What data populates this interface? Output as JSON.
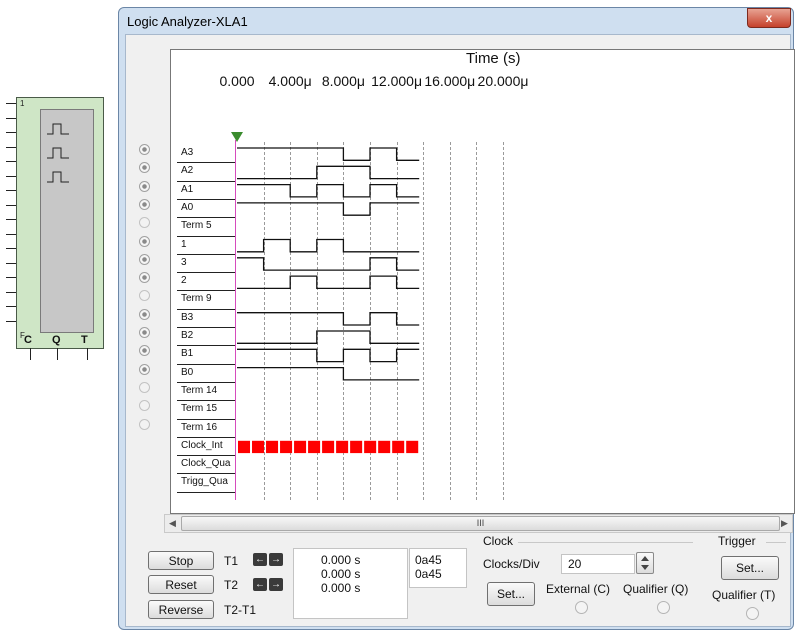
{
  "symbol": {
    "top_pin_label": "1",
    "bottom_pin_label": "F",
    "terminals": [
      "C",
      "Q",
      "T"
    ]
  },
  "window": {
    "title": "Logic Analyzer-XLA1",
    "close_glyph": "x"
  },
  "display": {
    "axis_title": "Time (s)",
    "tick_labels": [
      "0.000",
      "4.000μ",
      "8.000μ",
      "12.000μ",
      "16.000μ",
      "20.000μ"
    ],
    "rows": [
      {
        "label": "A3",
        "active": true,
        "level0": 1,
        "edges": [
          8,
          10,
          12
        ]
      },
      {
        "label": "A2",
        "active": true,
        "level0": 0,
        "edges": [
          6,
          10
        ]
      },
      {
        "label": "A1",
        "active": true,
        "level0": 1,
        "edges": [
          4,
          6,
          8,
          10,
          12
        ]
      },
      {
        "label": "A0",
        "active": true,
        "level0": 1,
        "edges": [
          8,
          10
        ]
      },
      {
        "label": "Term 5",
        "active": false
      },
      {
        "label": "1",
        "active": true,
        "level0": 0,
        "edges": [
          2,
          4,
          6,
          8
        ]
      },
      {
        "label": "3",
        "active": true,
        "level0": 1,
        "edges": [
          2,
          10,
          12
        ]
      },
      {
        "label": "2",
        "active": true,
        "level0": 0,
        "edges": [
          4,
          6,
          10,
          12
        ]
      },
      {
        "label": "Term 9",
        "active": false
      },
      {
        "label": "B3",
        "active": true,
        "level0": 1,
        "edges": [
          8,
          10,
          12
        ]
      },
      {
        "label": "B2",
        "active": true,
        "level0": 0,
        "edges": [
          6,
          10
        ]
      },
      {
        "label": "B1",
        "active": true,
        "level0": 1,
        "edges": [
          6,
          8,
          10,
          12
        ]
      },
      {
        "label": "B0",
        "active": true,
        "level0": 1,
        "edges": [
          8
        ]
      },
      {
        "label": "Term 14",
        "active": false
      },
      {
        "label": "Term 15",
        "active": false
      },
      {
        "label": "Term 16",
        "active": false
      },
      {
        "label": "Clock_Int",
        "active": false,
        "clock": true
      },
      {
        "label": "Clock_Qua",
        "active": false
      },
      {
        "label": "Trigg_Qua",
        "active": false
      }
    ],
    "trace_end_us": 13.7,
    "clock_cells": 13,
    "clock_color": "#ff0000",
    "trace_color": "#111111",
    "trigger_marker_color": "#3a8c2e"
  },
  "scrollbar": {
    "thumb_grip": "III",
    "left_arrow": "◀",
    "right_arrow": "▶"
  },
  "controls": {
    "stop_label": "Stop",
    "reset_label": "Reset",
    "reverse_label": "Reverse",
    "t1_label": "T1",
    "t2_label": "T2",
    "t2t1_label": "T2-T1",
    "t1_value": "0.000 s",
    "t2_value": "0.000 s",
    "t2t1_value": "0.000 s",
    "t1_hex": "0a45",
    "t2_hex": "0a45",
    "left_arrow": "←",
    "right_arrow": "→"
  },
  "clock": {
    "group_label": "Clock",
    "clocks_per_div_label": "Clocks/Div",
    "clocks_per_div_value": "20",
    "set_label": "Set...",
    "external_label": "External (C)",
    "qualifier_label": "Qualifier (Q)"
  },
  "trigger": {
    "group_label": "Trigger",
    "set_label": "Set...",
    "qualifier_label": "Qualifier (T)"
  }
}
